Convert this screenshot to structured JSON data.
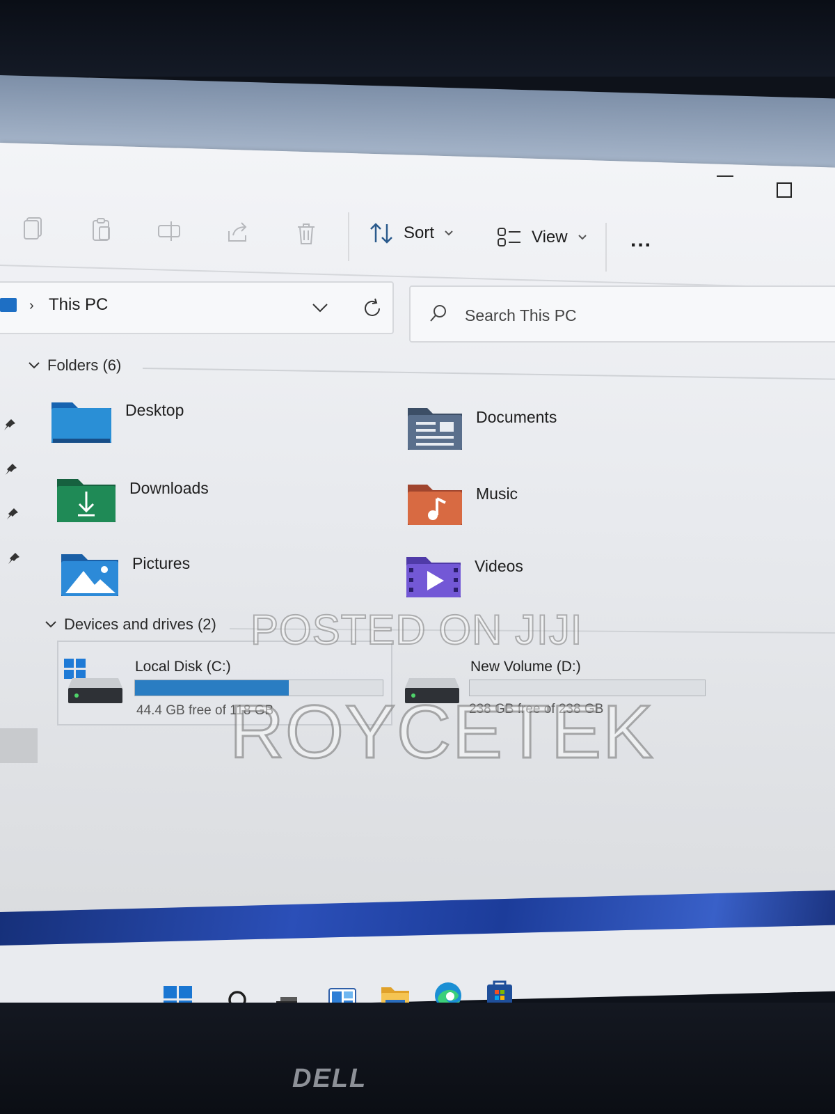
{
  "toolbar": {
    "sort_label": "Sort",
    "view_label": "View",
    "more_label": "..."
  },
  "address": {
    "path_item": "This PC"
  },
  "search": {
    "placeholder": "Search This PC"
  },
  "folders_section": {
    "title": "Folders (6)",
    "items": [
      {
        "label": "Desktop",
        "icon": "desktop-folder-icon"
      },
      {
        "label": "Documents",
        "icon": "documents-folder-icon"
      },
      {
        "label": "Downloads",
        "icon": "downloads-folder-icon"
      },
      {
        "label": "Music",
        "icon": "music-folder-icon"
      },
      {
        "label": "Pictures",
        "icon": "pictures-folder-icon"
      },
      {
        "label": "Videos",
        "icon": "videos-folder-icon"
      }
    ]
  },
  "drives_section": {
    "title": "Devices and drives (2)",
    "drives": [
      {
        "label": "Local Disk (C:)",
        "free_text": "44.4 GB free of 118 GB",
        "used_fraction": 0.62
      },
      {
        "label": "New Volume (D:)",
        "free_text": "238 GB free of 238 GB",
        "used_fraction": 0.0
      }
    ]
  },
  "watermark": {
    "line1": "POSTED ON JIJI",
    "line2": "ROYCETEK"
  },
  "bezel": {
    "brand": "DELL"
  },
  "colors": {
    "accent": "#2a7dc2",
    "drive_bar_track": "#dcdfe3"
  }
}
